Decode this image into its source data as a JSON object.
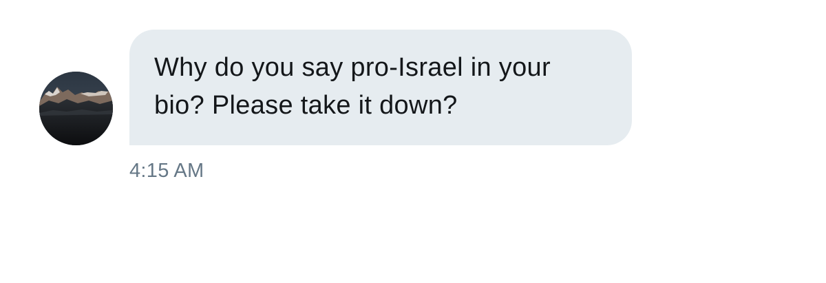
{
  "message": {
    "text": "Why do you say pro-Israel in your bio? Please take it down?",
    "timestamp": "4:15 AM",
    "sender_avatar": {
      "icon": "mountain-avatar"
    }
  },
  "colors": {
    "bubble_background": "#e6ecf0",
    "message_text": "#14171a",
    "timestamp_text": "#657786",
    "page_background": "#ffffff"
  }
}
